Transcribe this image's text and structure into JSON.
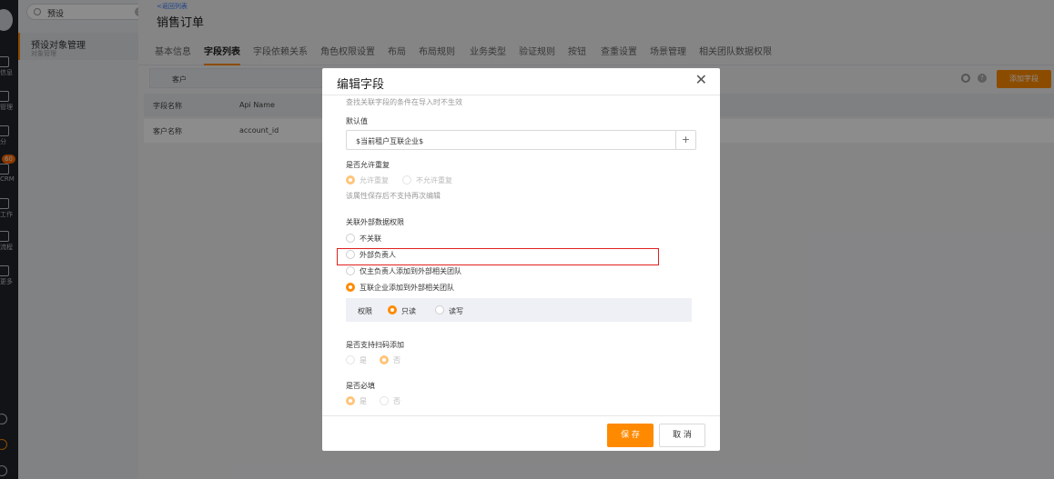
{
  "leftnav": {
    "search_value": "预设",
    "item_title": "预设对象管理",
    "item_sub": "对象管理"
  },
  "rail": {
    "labels": [
      "信息",
      "管理",
      "分",
      "CRM",
      "工作",
      "流程",
      "更多"
    ],
    "badge": "60"
  },
  "header": {
    "back": "<返回列表",
    "title": "销售订单"
  },
  "tabs": [
    "基本信息",
    "字段列表",
    "字段依赖关系",
    "角色权限设置",
    "布局",
    "布局规则",
    "业务类型",
    "验证规则",
    "按钮",
    "查重设置",
    "场景管理",
    "相关团队数据权限"
  ],
  "toolbar": {
    "subtab": "客户",
    "add_field": "添加字段"
  },
  "table": {
    "headers": [
      "字段名称",
      "Api Name"
    ],
    "rows": [
      [
        "客户名称",
        "account_id"
      ]
    ]
  },
  "modal": {
    "title": "编辑字段",
    "truncated_hint": "查找关联字段的条件在导入时不生效",
    "default_label": "默认值",
    "default_value": "$当前租户互联企业$",
    "dup_label": "是否允许重复",
    "dup_options": [
      "允许重复",
      "不允许重复"
    ],
    "dup_note": "该属性保存后不支持再次编辑",
    "ext_label": "关联外部数据权限",
    "ext_options": [
      "不关联",
      "外部负责人",
      "仅主负责人添加到外部相关团队",
      "互联企业添加到外部相关团队"
    ],
    "perm_label": "权限",
    "perm_options": [
      "只读",
      "读写"
    ],
    "scan_label": "是否支持扫码添加",
    "scan_options": [
      "是",
      "否"
    ],
    "req_label": "是否必填",
    "req_options": [
      "是",
      "否"
    ],
    "save": "保 存",
    "cancel": "取 消"
  }
}
